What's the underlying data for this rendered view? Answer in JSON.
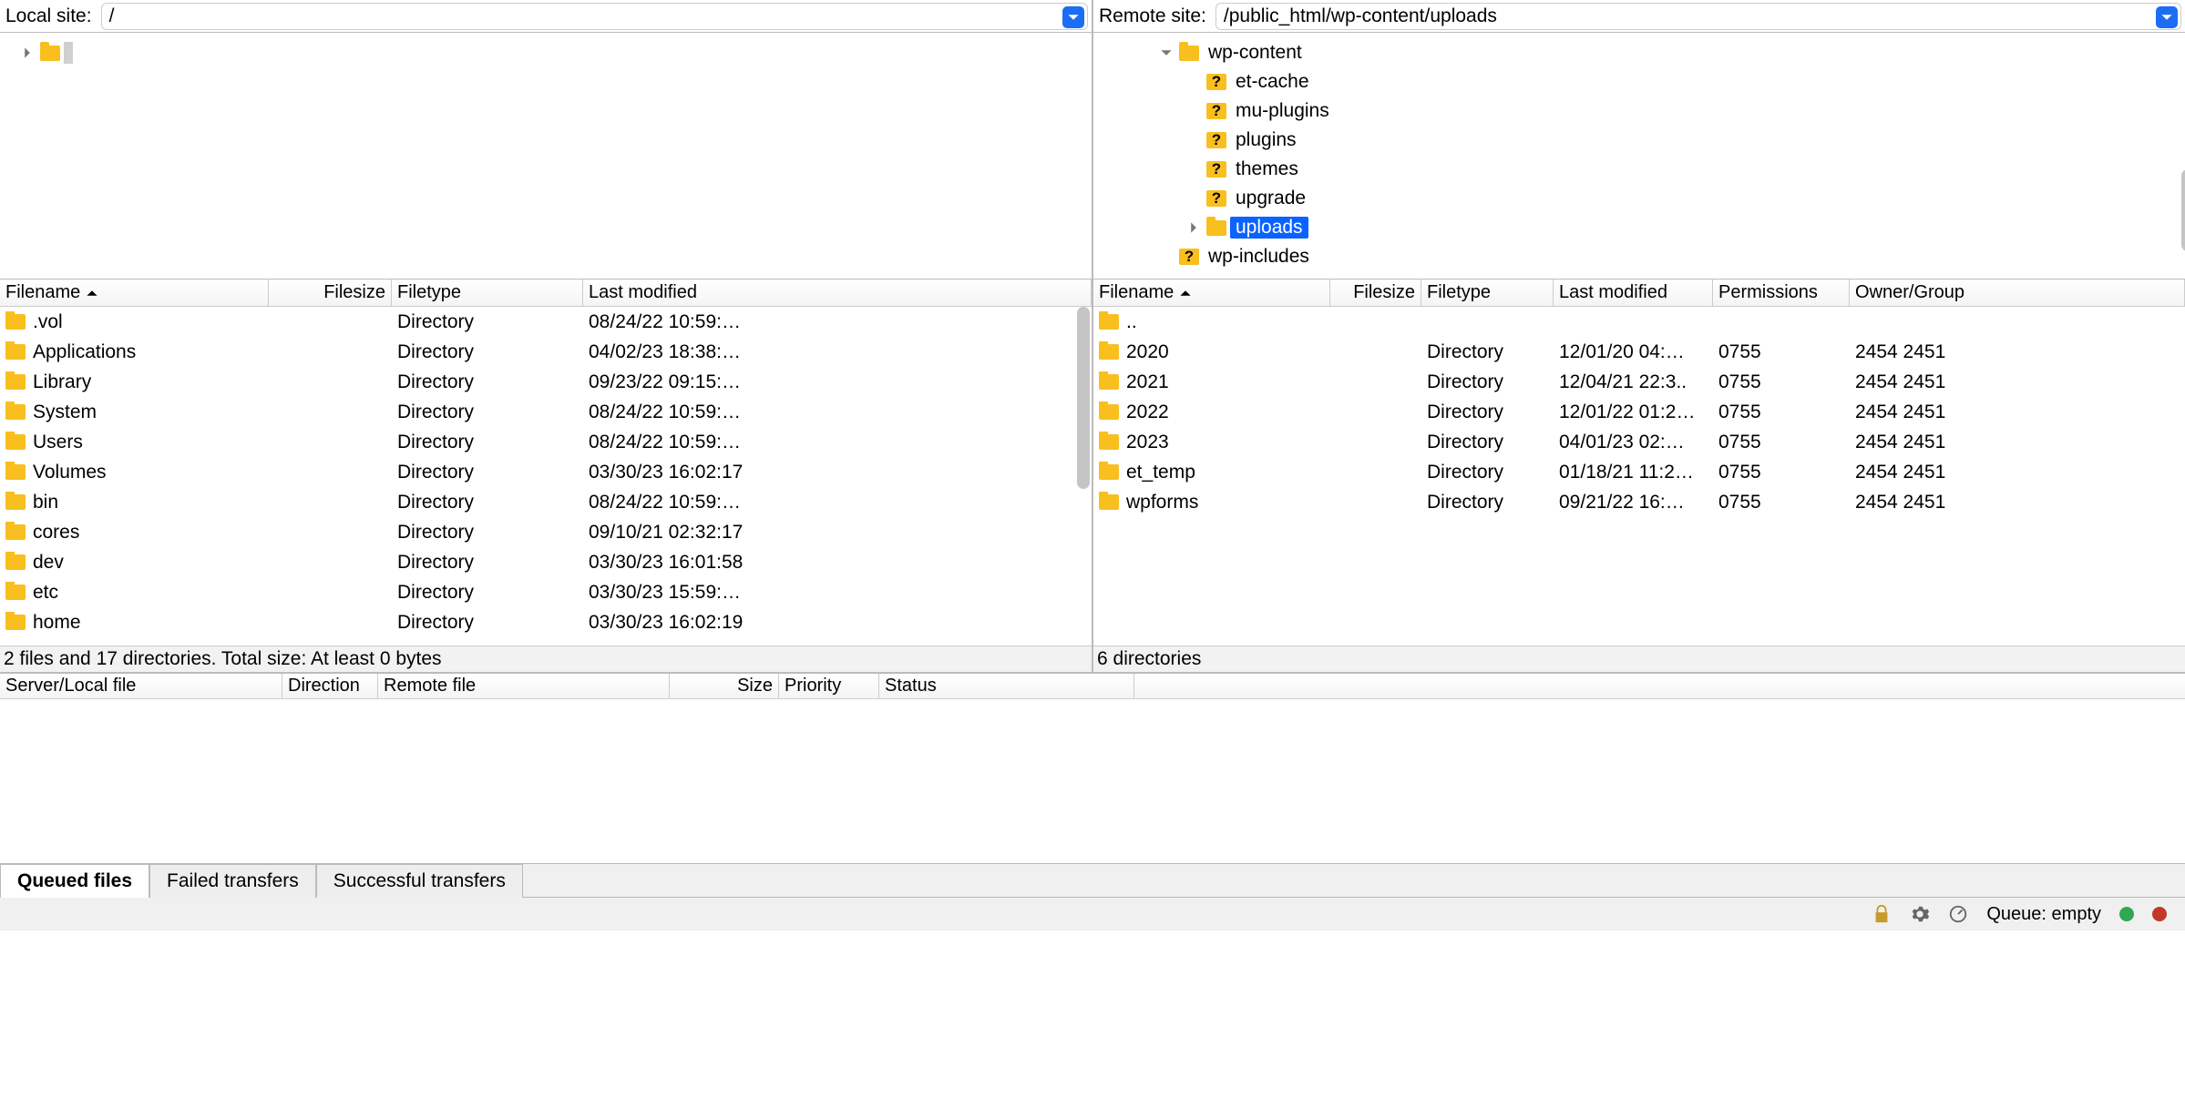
{
  "local": {
    "label": "Local site:",
    "path": "/",
    "columns": [
      "Filename",
      "Filesize",
      "Filetype",
      "Last modified"
    ],
    "rows": [
      {
        "name": ".vol",
        "type": "Directory",
        "mod": "08/24/22 10:59:…"
      },
      {
        "name": "Applications",
        "type": "Directory",
        "mod": "04/02/23 18:38:…"
      },
      {
        "name": "Library",
        "type": "Directory",
        "mod": "09/23/22 09:15:…"
      },
      {
        "name": "System",
        "type": "Directory",
        "mod": "08/24/22 10:59:…"
      },
      {
        "name": "Users",
        "type": "Directory",
        "mod": "08/24/22 10:59:…"
      },
      {
        "name": "Volumes",
        "type": "Directory",
        "mod": "03/30/23 16:02:17"
      },
      {
        "name": "bin",
        "type": "Directory",
        "mod": "08/24/22 10:59:…"
      },
      {
        "name": "cores",
        "type": "Directory",
        "mod": "09/10/21 02:32:17"
      },
      {
        "name": "dev",
        "type": "Directory",
        "mod": "03/30/23 16:01:58"
      },
      {
        "name": "etc",
        "type": "Directory",
        "mod": "03/30/23 15:59:…"
      },
      {
        "name": "home",
        "type": "Directory",
        "mod": "03/30/23 16:02:19"
      }
    ],
    "status": "2 files and 17 directories. Total size: At least 0 bytes"
  },
  "remote": {
    "label": "Remote site:",
    "path": "/public_html/wp-content/uploads",
    "tree_parent": "wp-content",
    "tree_children": [
      "et-cache",
      "mu-plugins",
      "plugins",
      "themes",
      "upgrade"
    ],
    "tree_selected": "uploads",
    "tree_after": "wp-includes",
    "columns": [
      "Filename",
      "Filesize",
      "Filetype",
      "Last modified",
      "Permissions",
      "Owner/Group"
    ],
    "rows": [
      {
        "name": "..",
        "type": "",
        "mod": "",
        "perm": "",
        "own": ""
      },
      {
        "name": "2020",
        "type": "Directory",
        "mod": "12/01/20 04:…",
        "perm": "0755",
        "own": "2454 2451"
      },
      {
        "name": "2021",
        "type": "Directory",
        "mod": "12/04/21 22:3..",
        "perm": "0755",
        "own": "2454 2451"
      },
      {
        "name": "2022",
        "type": "Directory",
        "mod": "12/01/22 01:2…",
        "perm": "0755",
        "own": "2454 2451"
      },
      {
        "name": "2023",
        "type": "Directory",
        "mod": "04/01/23 02:…",
        "perm": "0755",
        "own": "2454 2451"
      },
      {
        "name": "et_temp",
        "type": "Directory",
        "mod": "01/18/21 11:2…",
        "perm": "0755",
        "own": "2454 2451"
      },
      {
        "name": "wpforms",
        "type": "Directory",
        "mod": "09/21/22 16:…",
        "perm": "0755",
        "own": "2454 2451"
      }
    ],
    "status": "6 directories"
  },
  "queue": {
    "columns": [
      "Server/Local file",
      "Direction",
      "Remote file",
      "Size",
      "Priority",
      "Status"
    ]
  },
  "tabs": [
    "Queued files",
    "Failed transfers",
    "Successful transfers"
  ],
  "bottom": {
    "queue": "Queue: empty"
  }
}
